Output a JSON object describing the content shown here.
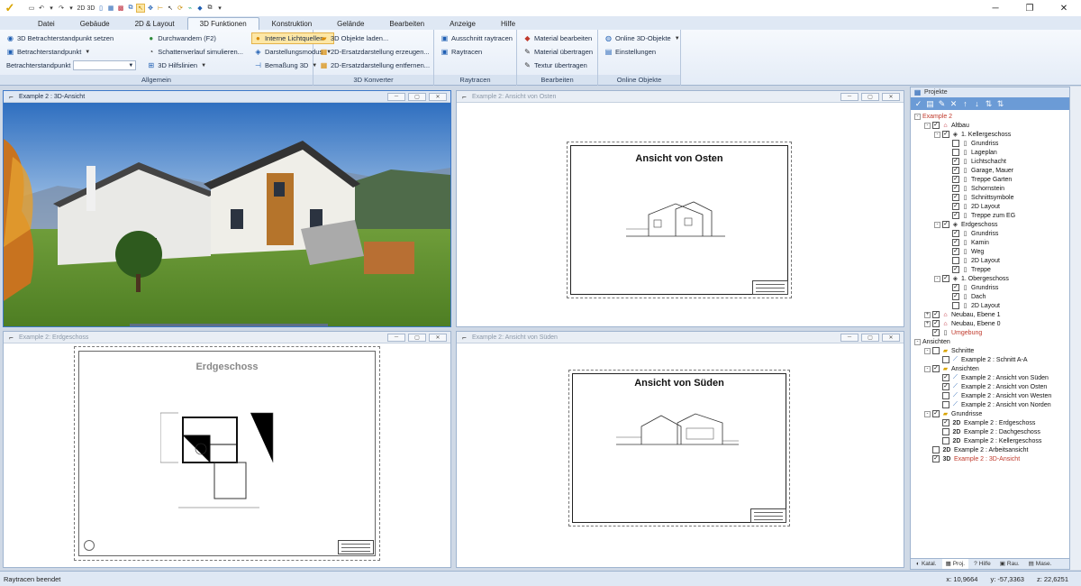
{
  "titlebar": {
    "window_controls": [
      "─",
      "❐",
      "✕"
    ]
  },
  "tabs": [
    "Datei",
    "Gebäude",
    "2D & Layout",
    "3D Funktionen",
    "Konstruktion",
    "Gelände",
    "Bearbeiten",
    "Anzeige",
    "Hilfe"
  ],
  "ribbon": {
    "allgemein": {
      "label": "Allgemein",
      "items": {
        "set_view": "3D Betrachterstandpunkt setzen",
        "view_point": "Betrachterstandpunkt",
        "view_point_label": "Betrachterstandpunkt",
        "walk": "Durchwandern (F2)",
        "shadow": "Schattenverlauf simulieren...",
        "helper": "3D Hilfslinien",
        "lights": "Interne Lichtquellen",
        "display_mode": "Darstellungsmodus",
        "dimension": "Bemaßung 3D"
      }
    },
    "converter": {
      "label": "3D Konverter",
      "items": [
        "3D Objekte laden...",
        "2D-Ersatzdarstellung erzeugen...",
        "2D-Ersatzdarstellung entfernen..."
      ]
    },
    "raytracen": {
      "label": "Raytracen",
      "items": [
        "Ausschnitt raytracen",
        "Raytracen"
      ]
    },
    "bearbeiten": {
      "label": "Bearbeiten",
      "items": [
        "Material bearbeiten",
        "Material übertragen",
        "Textur übertragen"
      ]
    },
    "online": {
      "label": "Online Objekte",
      "items": [
        "Online 3D-Objekte",
        "Einstellungen"
      ]
    }
  },
  "viewports": {
    "v3d": {
      "title": "Example 2 : 3D-Ansicht"
    },
    "east": {
      "title": "Example 2: Ansicht von Osten",
      "sheet_title": "Ansicht von Osten"
    },
    "floor": {
      "title": "Example 2: Erdgeschoss",
      "sheet_title": "Erdgeschoss"
    },
    "south": {
      "title": "Example 2: Ansicht von Süden",
      "sheet_title": "Ansicht von Süden"
    }
  },
  "projects": {
    "header": "Projekte",
    "tree": [
      {
        "label": "Example 2",
        "level": 0,
        "expand": "-",
        "red": true
      },
      {
        "label": "Altbau",
        "level": 1,
        "expand": "-",
        "check": "✓",
        "icon": "house"
      },
      {
        "label": "1. Kellergeschoss",
        "level": 2,
        "expand": "-",
        "check": "✓",
        "icon": "floor"
      },
      {
        "label": "Grundriss",
        "level": 3,
        "check": "",
        "icon": "page"
      },
      {
        "label": "Lageplan",
        "level": 3,
        "check": "",
        "icon": "page"
      },
      {
        "label": "Lichtschacht",
        "level": 3,
        "check": "✓",
        "icon": "page"
      },
      {
        "label": "Garage, Mauer",
        "level": 3,
        "check": "✓",
        "icon": "page"
      },
      {
        "label": "Treppe Garten",
        "level": 3,
        "check": "✓",
        "icon": "page"
      },
      {
        "label": "Schornstein",
        "level": 3,
        "check": "✓",
        "icon": "page"
      },
      {
        "label": "Schnittsymbole",
        "level": 3,
        "check": "✓",
        "icon": "page"
      },
      {
        "label": "2D Layout",
        "level": 3,
        "check": "✓",
        "icon": "page"
      },
      {
        "label": "Treppe zum EG",
        "level": 3,
        "check": "✓",
        "icon": "page"
      },
      {
        "label": "Erdgeschoss",
        "level": 2,
        "expand": "-",
        "check": "✓",
        "icon": "floor"
      },
      {
        "label": "Grundriss",
        "level": 3,
        "check": "✓",
        "icon": "page"
      },
      {
        "label": "Kamin",
        "level": 3,
        "check": "✓",
        "icon": "page"
      },
      {
        "label": "Weg",
        "level": 3,
        "check": "✓",
        "icon": "page"
      },
      {
        "label": "2D Layout",
        "level": 3,
        "check": "",
        "icon": "page"
      },
      {
        "label": "Treppe",
        "level": 3,
        "check": "✓",
        "icon": "page"
      },
      {
        "label": "1. Obergeschoss",
        "level": 2,
        "expand": "-",
        "check": "✓",
        "icon": "floor"
      },
      {
        "label": "Grundriss",
        "level": 3,
        "check": "✓",
        "icon": "page"
      },
      {
        "label": "Dach",
        "level": 3,
        "check": "✓",
        "icon": "page"
      },
      {
        "label": "2D Layout",
        "level": 3,
        "check": "",
        "icon": "page"
      },
      {
        "label": "Neubau, Ebene 1",
        "level": 1,
        "expand": "+",
        "check": "✓",
        "icon": "house"
      },
      {
        "label": "Neubau, Ebene 0",
        "level": 1,
        "expand": "+",
        "check": "✓",
        "icon": "house"
      },
      {
        "label": "Umgebung",
        "level": 1,
        "check": "✓",
        "icon": "page",
        "red": true
      },
      {
        "label": "Ansichten",
        "level": 0,
        "expand": "-"
      },
      {
        "label": "Schnitte",
        "level": 1,
        "expand": "-",
        "check": "",
        "icon": "folder"
      },
      {
        "label": "Example 2 : Schnitt A-A",
        "level": 2,
        "check": "",
        "icon": "line"
      },
      {
        "label": "Ansichten",
        "level": 1,
        "expand": "-",
        "check": "✓",
        "icon": "folder"
      },
      {
        "label": "Example 2 : Ansicht von Süden",
        "level": 2,
        "check": "✓",
        "icon": "line"
      },
      {
        "label": "Example 2 : Ansicht von Osten",
        "level": 2,
        "check": "✓",
        "icon": "line"
      },
      {
        "label": "Example 2 : Ansicht von Westen",
        "level": 2,
        "check": "",
        "icon": "line"
      },
      {
        "label": "Example 2 : Ansicht von Norden",
        "level": 2,
        "check": "",
        "icon": "line"
      },
      {
        "label": "Grundrisse",
        "level": 1,
        "expand": "-",
        "check": "✓",
        "icon": "folder"
      },
      {
        "label": "Example 2 : Erdgeschoss",
        "level": 2,
        "check": "✓",
        "icon": "2D"
      },
      {
        "label": "Example 2 : Dachgeschoss",
        "level": 2,
        "check": "",
        "icon": "2D"
      },
      {
        "label": "Example 2 : Kellergeschoss",
        "level": 2,
        "check": "",
        "icon": "2D"
      },
      {
        "label": "Example 2 : Arbeitsansicht",
        "level": 1,
        "check": "",
        "icon": "2D"
      },
      {
        "label": "Example 2 : 3D-Ansicht",
        "level": 1,
        "check": "✓",
        "icon": "3D",
        "red": true
      }
    ],
    "bottom_tabs": [
      "Katal.",
      "Proj.",
      "Hilfe",
      "Rau.",
      "Mase."
    ]
  },
  "status": {
    "message": "Raytracen beendet",
    "x": "x: 10,9664",
    "y": "y: -57,3363",
    "z": "z: 22,6251"
  },
  "colors": {
    "accent": "#1f5fb3",
    "highlight": "#fde7a6",
    "red_item": "#c0392b"
  }
}
